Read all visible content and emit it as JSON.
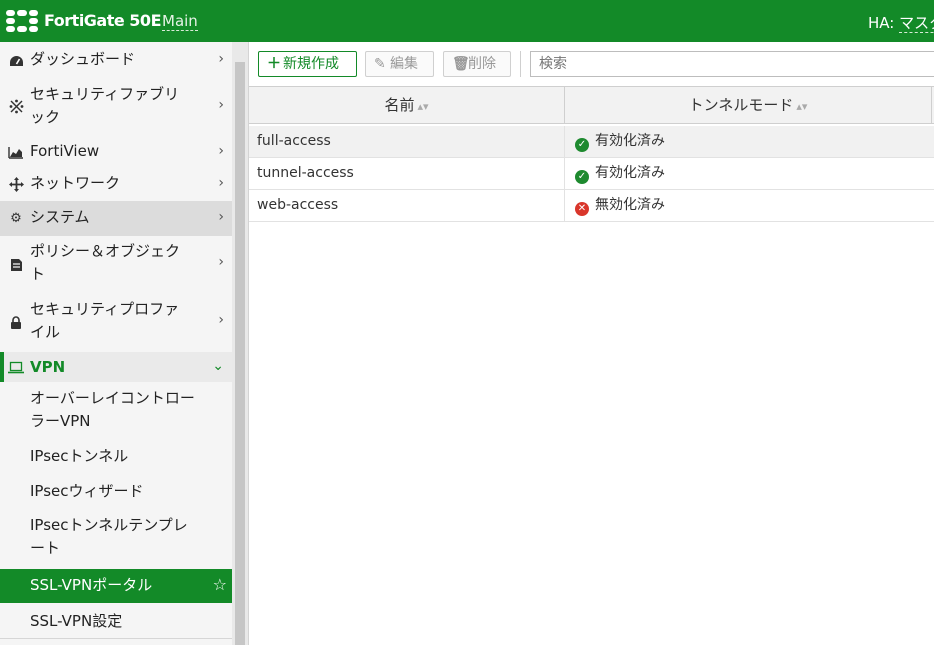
{
  "header": {
    "product": "FortiGate 50E",
    "vdom": "Main",
    "ha_label": "HA:",
    "ha_value": "マスタ",
    "brand_color": "#138a28"
  },
  "sidebar": {
    "items": [
      {
        "label": "ダッシュボード",
        "icon": "dashboard-icon"
      },
      {
        "label": "セキュリティファブリック",
        "icon": "fabric-icon"
      },
      {
        "label": "FortiView",
        "icon": "chart-icon"
      },
      {
        "label": "ネットワーク",
        "icon": "network-icon"
      },
      {
        "label": "システム",
        "icon": "gear-icon"
      },
      {
        "label": "ポリシー＆オブジェクト",
        "icon": "policy-icon"
      },
      {
        "label": "セキュリティプロファイル",
        "icon": "lock-icon"
      },
      {
        "label": "VPN",
        "icon": "laptop-icon"
      }
    ],
    "vpn_subitems": [
      {
        "label": "オーバーレイコントローラーVPN"
      },
      {
        "label": "IPsecトンネル"
      },
      {
        "label": "IPsecウィザード"
      },
      {
        "label": "IPsecトンネルテンプレート"
      },
      {
        "label": "SSL-VPNポータル"
      },
      {
        "label": "SSL-VPN設定"
      }
    ]
  },
  "toolbar": {
    "create_label": "新規作成",
    "edit_label": "編集",
    "delete_label": "削除",
    "search_placeholder": "検索"
  },
  "table": {
    "columns": [
      "名前",
      "トンネルモード"
    ],
    "rows": [
      {
        "name": "full-access",
        "mode": "有効化済み",
        "status": "enabled"
      },
      {
        "name": "tunnel-access",
        "mode": "有効化済み",
        "status": "enabled"
      },
      {
        "name": "web-access",
        "mode": "無効化済み",
        "status": "disabled"
      }
    ]
  }
}
